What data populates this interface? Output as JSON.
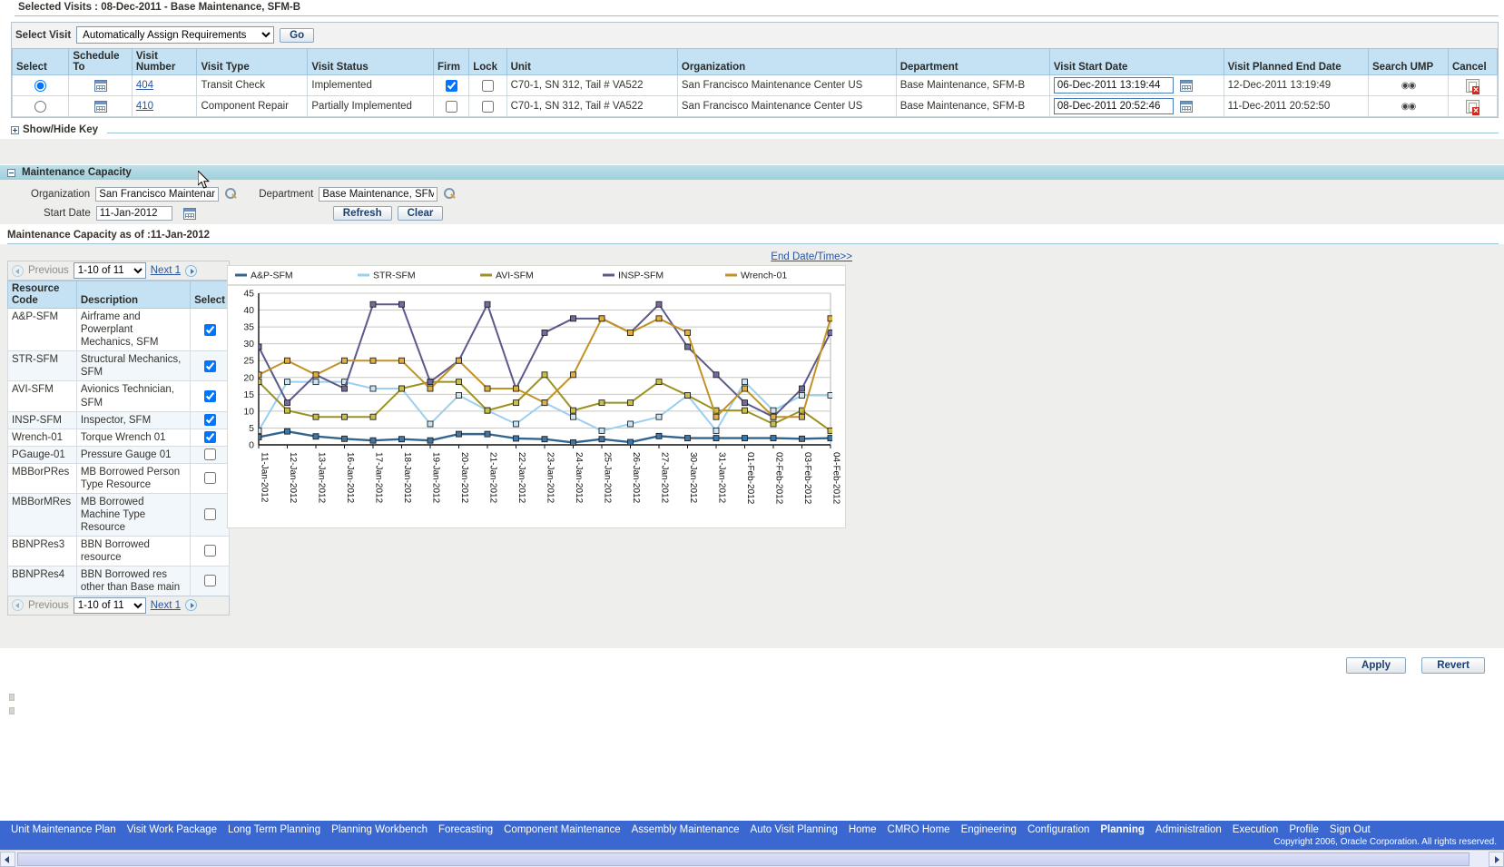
{
  "selected_visits": {
    "title": "Selected Visits : 08-Dec-2011 - Base Maintenance, SFM-B",
    "select_visit_label": "Select Visit",
    "select_visit_value": "Automatically Assign Requirements",
    "select_visit_options": [
      "Automatically Assign Requirements"
    ],
    "go_label": "Go",
    "columns": [
      "Select",
      "Schedule To",
      "Visit Number",
      "Visit Type",
      "Visit Status",
      "Firm",
      "Lock",
      "Unit",
      "Organization",
      "Department",
      "Visit Start Date",
      "Visit Planned End Date",
      "Search UMP",
      "Cancel"
    ],
    "rows": [
      {
        "selected": true,
        "visit_number": "404",
        "visit_type": "Transit Check",
        "visit_status": "Implemented",
        "firm": true,
        "lock": false,
        "unit": "C70-1, SN 312, Tail # VA522",
        "organization": "San Francisco Maintenance Center US",
        "department": "Base Maintenance, SFM-B",
        "visit_start_date": "06-Dec-2011 13:19:44",
        "visit_planned_end_date": "12-Dec-2011 13:19:49"
      },
      {
        "selected": false,
        "visit_number": "410",
        "visit_type": "Component Repair",
        "visit_status": "Partially Implemented",
        "firm": false,
        "lock": false,
        "unit": "C70-1, SN 312, Tail # VA522",
        "organization": "San Francisco Maintenance Center US",
        "department": "Base Maintenance, SFM-B",
        "visit_start_date": "08-Dec-2011 20:52:46",
        "visit_planned_end_date": "11-Dec-2011 20:52:50"
      }
    ]
  },
  "show_hide_key": "Show/Hide Key",
  "maintenance_capacity": {
    "header": "Maintenance Capacity",
    "organization_label": "Organization",
    "organization_value": "San Francisco Maintenan",
    "department_label": "Department",
    "department_value": "Base Maintenance, SFM-",
    "start_date_label": "Start Date",
    "start_date_value": "11-Jan-2012",
    "refresh_label": "Refresh",
    "clear_label": "Clear",
    "as_of_title": "Maintenance Capacity as of :11-Jan-2012"
  },
  "end_date_link": "End Date/Time>>",
  "resource_table": {
    "pager": {
      "previous_label": "Previous",
      "range_value": "1-10 of 11",
      "range_options": [
        "1-10 of 11"
      ],
      "next_label": "Next 1"
    },
    "columns": [
      "Resource Code",
      "Description",
      "Select"
    ],
    "rows": [
      {
        "code": "A&P-SFM",
        "description": "Airframe and Powerplant Mechanics, SFM",
        "selected": true
      },
      {
        "code": "STR-SFM",
        "description": "Structural Mechanics, SFM",
        "selected": true
      },
      {
        "code": "AVI-SFM",
        "description": "Avionics Technician, SFM",
        "selected": true
      },
      {
        "code": "INSP-SFM",
        "description": "Inspector, SFM",
        "selected": true
      },
      {
        "code": "Wrench-01",
        "description": "Torque Wrench 01",
        "selected": true
      },
      {
        "code": "PGauge-01",
        "description": "Pressure Gauge 01",
        "selected": false
      },
      {
        "code": "MBBorPRes",
        "description": "MB Borrowed Person Type Resource",
        "selected": false
      },
      {
        "code": "MBBorMRes",
        "description": "MB Borrowed Machine Type Resource",
        "selected": false
      },
      {
        "code": "BBNPRes3",
        "description": "BBN Borrowed resource",
        "selected": false
      },
      {
        "code": "BBNPRes4",
        "description": "BBN Borrowed res other than Base main",
        "selected": false
      }
    ]
  },
  "chart_data": {
    "type": "line",
    "title": "",
    "xlabel": "",
    "ylabel": "",
    "ylim": [
      0,
      45
    ],
    "yticks": [
      0,
      5,
      10,
      15,
      20,
      25,
      30,
      35,
      40,
      45
    ],
    "grid": true,
    "legend_position": "top",
    "x": [
      "11-Jan-2012",
      "12-Jan-2012",
      "13-Jan-2012",
      "16-Jan-2012",
      "17-Jan-2012",
      "18-Jan-2012",
      "19-Jan-2012",
      "20-Jan-2012",
      "21-Jan-2012",
      "22-Jan-2012",
      "23-Jan-2012",
      "24-Jan-2012",
      "25-Jan-2012",
      "26-Jan-2012",
      "27-Jan-2012",
      "30-Jan-2012",
      "31-Jan-2012",
      "01-Feb-2012",
      "02-Feb-2012",
      "03-Feb-2012",
      "04-Feb-2012"
    ],
    "series": [
      {
        "name": "A&P-SFM",
        "color": "#33658f",
        "values": [
          2.3,
          4.0,
          2.5,
          1.8,
          1.3,
          1.7,
          1.3,
          3.2,
          3.2,
          1.9,
          1.7,
          0.7,
          1.7,
          0.8,
          2.6,
          2.0,
          2.0,
          2.0,
          2.0,
          1.8,
          2.0
        ]
      },
      {
        "name": "STR-SFM",
        "color": "#9ccfee",
        "values": [
          4.2,
          18.7,
          18.7,
          18.7,
          16.7,
          16.7,
          6.2,
          14.7,
          10.2,
          6.2,
          12.5,
          8.3,
          4.2,
          6.2,
          8.3,
          14.7,
          4.2,
          18.7,
          10.2,
          14.7,
          14.7
        ]
      },
      {
        "name": "AVI-SFM",
        "color": "#9b9222",
        "values": [
          18.7,
          10.2,
          8.3,
          8.3,
          8.3,
          16.7,
          18.7,
          18.7,
          10.2,
          12.5,
          20.8,
          10.2,
          12.5,
          12.5,
          18.7,
          14.7,
          10.2,
          10.2,
          6.2,
          10.2,
          4.2
        ]
      },
      {
        "name": "INSP-SFM",
        "color": "#5b5a8c",
        "values": [
          29.1,
          12.5,
          20.8,
          16.7,
          41.7,
          41.7,
          18.7,
          25.0,
          41.7,
          16.7,
          33.3,
          37.5,
          37.5,
          33.3,
          41.7,
          29.1,
          20.8,
          12.5,
          8.3,
          16.7,
          33.3
        ]
      },
      {
        "name": "Wrench-01",
        "color": "#c19226",
        "values": [
          20.8,
          25.0,
          20.8,
          25.0,
          25.0,
          25.0,
          16.7,
          25.0,
          16.7,
          16.7,
          12.5,
          20.8,
          37.5,
          33.3,
          37.5,
          33.3,
          8.3,
          16.7,
          8.3,
          8.3,
          37.5
        ]
      }
    ]
  },
  "actions": {
    "apply_label": "Apply",
    "revert_label": "Revert"
  },
  "footer": {
    "links": [
      "Unit Maintenance Plan",
      "Visit Work Package",
      "Long Term Planning",
      "Planning Workbench",
      "Forecasting",
      "Component Maintenance",
      "Assembly Maintenance",
      "Auto Visit Planning",
      "Home",
      "CMRO Home",
      "Engineering",
      "Configuration",
      "Planning",
      "Administration",
      "Execution",
      "Profile",
      "Sign Out"
    ],
    "active": "Planning",
    "copyright": "Copyright 2006, Oracle Corporation. All rights reserved."
  },
  "colors": {
    "header_band": "#9fd0dd",
    "table_header": "#c5e2f5",
    "footer_nav": "#3b68d0",
    "link": "#2854a0"
  }
}
